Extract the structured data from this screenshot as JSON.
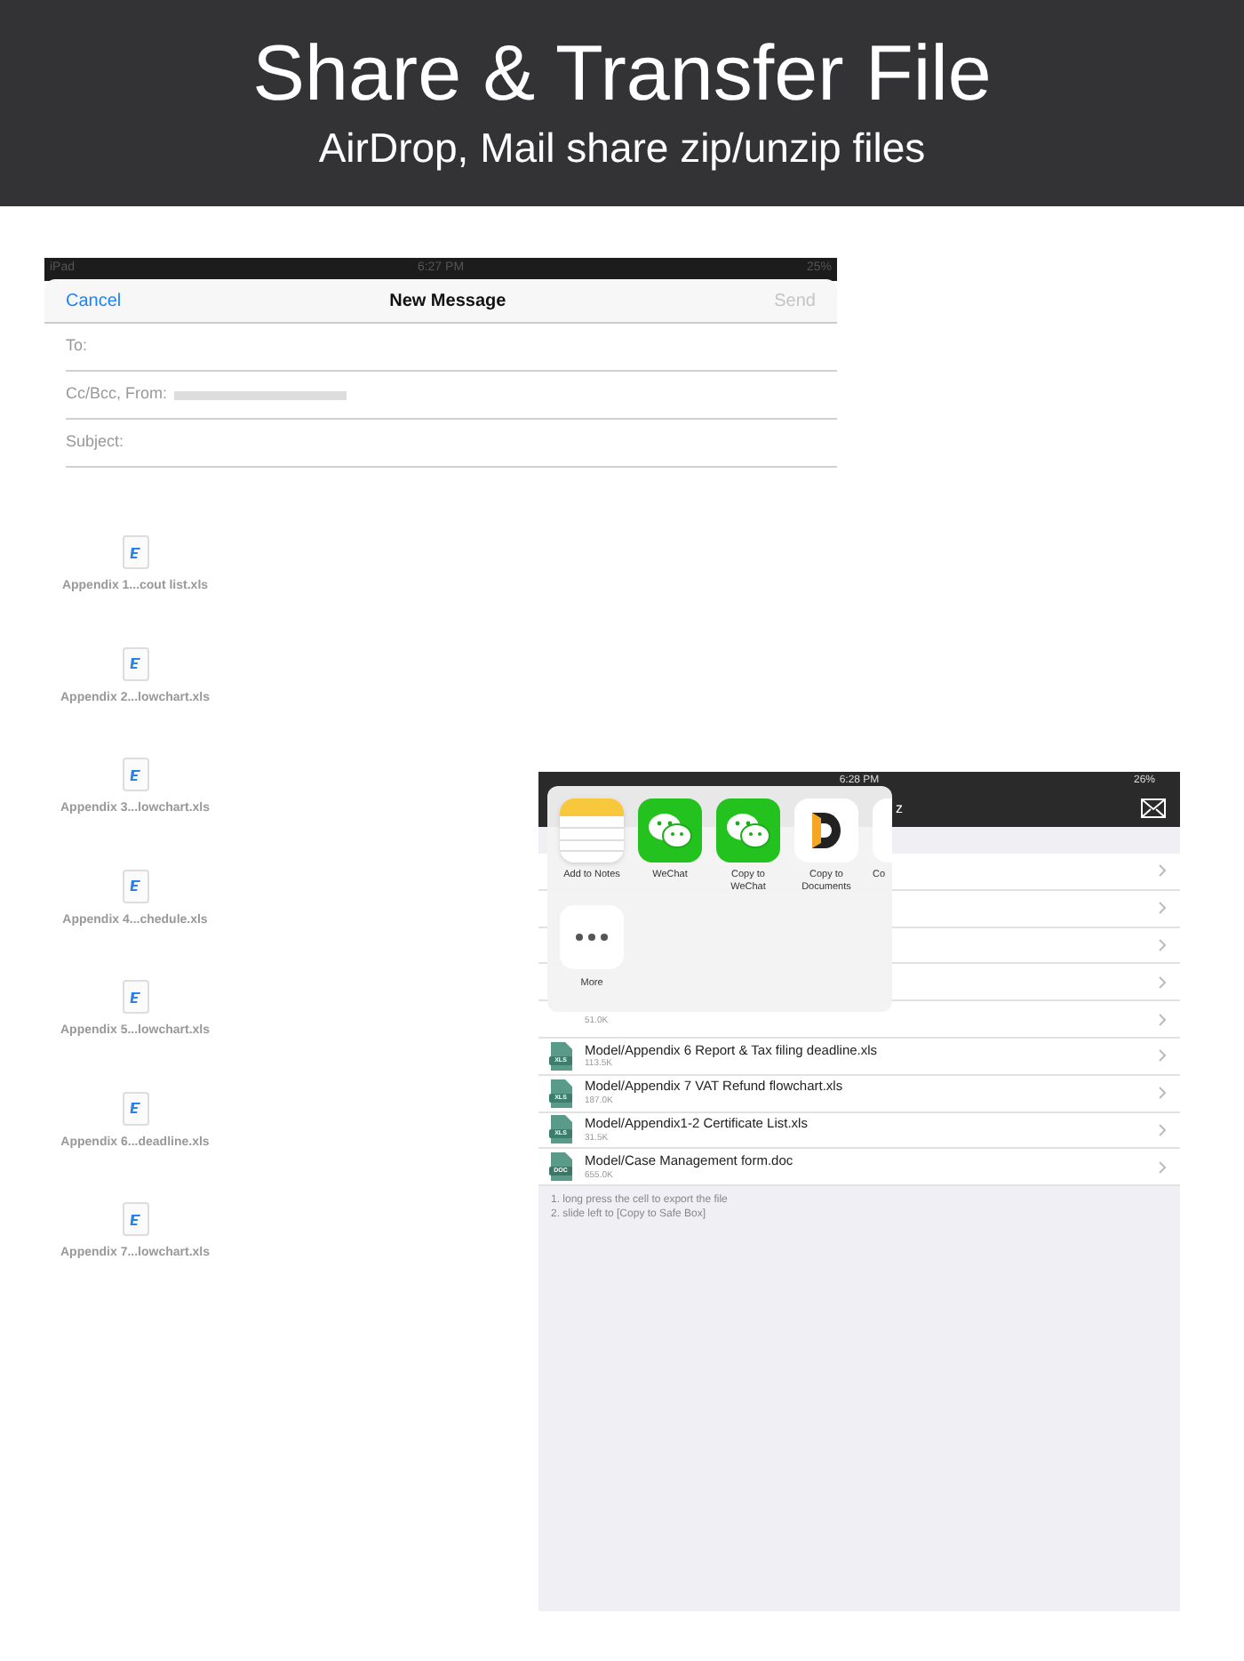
{
  "banner": {
    "title": "Share & Transfer File",
    "subtitle": "AirDrop, Mail share zip/unzip files"
  },
  "mail": {
    "status_bar": {
      "carrier": "iPad",
      "time": "6:27 PM",
      "battery": "25%"
    },
    "cancel": "Cancel",
    "title": "New Message",
    "send": "Send",
    "send_disabled": true,
    "fields": [
      {
        "label": "To:"
      },
      {
        "label": "Cc/Bcc, From:",
        "redacted": true
      },
      {
        "label": "Subject:"
      }
    ]
  },
  "attachments": [
    {
      "name": "Appendix 1...cout list.xls"
    },
    {
      "name": "Appendix 2...lowchart.xls"
    },
    {
      "name": "Appendix 3...lowchart.xls"
    },
    {
      "name": "Appendix 4...chedule.xls"
    },
    {
      "name": "Appendix 5...lowchart.xls"
    },
    {
      "name": "Appendix 6...deadline.xls"
    },
    {
      "name": "Appendix 7...lowchart.xls"
    }
  ],
  "ipad": {
    "status_bar": {
      "time": "6:28 PM",
      "battery": "26%"
    },
    "nav_title": "z",
    "rows": [
      {},
      {},
      {},
      {},
      {
        "size": "51.0K"
      },
      {
        "name": "Model/Appendix 6 Report & Tax filing deadline.xls",
        "size": "113.5K",
        "type": "XLS"
      },
      {
        "name": "Model/Appendix 7 VAT Refund flowchart.xls",
        "size": "187.0K",
        "type": "XLS"
      },
      {
        "name": "Model/Appendix1-2 Certificate List.xls",
        "size": "31.5K",
        "type": "XLS"
      },
      {
        "name": "Model/Case Management form.doc",
        "size": "655.0K",
        "type": "DOC"
      }
    ],
    "tips": [
      "1. long press the cell to export the file",
      "2. slide left to [Copy to Safe Box]"
    ],
    "share": {
      "apps": [
        {
          "kind": "notes",
          "label": "Add to Notes"
        },
        {
          "kind": "wechat",
          "label": "WeChat"
        },
        {
          "kind": "wechat",
          "label": "Copy to WeChat"
        },
        {
          "kind": "documents",
          "label": "Copy to Documents"
        },
        {
          "kind": "cut",
          "label": "Co"
        }
      ],
      "actions": [
        {
          "kind": "more",
          "label": "More"
        }
      ]
    }
  }
}
